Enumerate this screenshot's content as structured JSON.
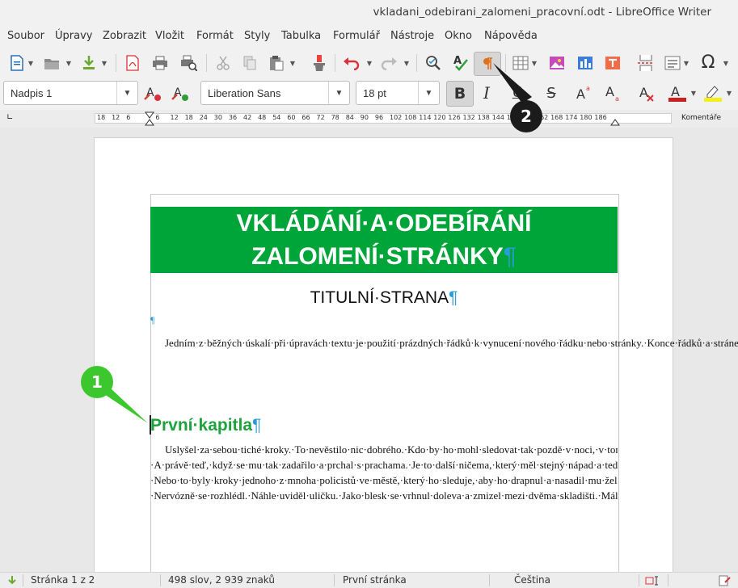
{
  "window": {
    "title": "vkladani_odebirani_zalomeni_pracovní.odt - LibreOffice Writer"
  },
  "menu": [
    "Soubor",
    "Úpravy",
    "Zobrazit",
    "Vložit",
    "Formát",
    "Styly",
    "Tabulka",
    "Formulář",
    "Nástroje",
    "Okno",
    "Nápověda"
  ],
  "format_bar": {
    "paragraph_style": "Nadpis 1",
    "font_name": "Liberation Sans",
    "font_size": "18 pt"
  },
  "ruler": {
    "numbers": [
      "18",
      "12",
      "6",
      "",
      "6",
      "12",
      "18",
      "24",
      "30",
      "36",
      "42",
      "48",
      "54",
      "60",
      "66",
      "72",
      "78",
      "84",
      "90",
      "96",
      "102",
      "108",
      "114",
      "120",
      "126",
      "132",
      "138",
      "144",
      "150",
      "156",
      "162",
      "168",
      "174",
      "180",
      "186"
    ],
    "comments_label": "Komentáře"
  },
  "document": {
    "title_line1": "VKLÁDÁNÍ·A·ODEBÍRÁNÍ",
    "title_line2": "ZALOMENÍ·STRÁNKY",
    "pilcrow": "¶",
    "subtitle": "TITULNÍ·STRANA",
    "intro": "Jedním·z·běžných·úskalí·při·úpravách·textu·je·použití·prázdných·řádků·k·vynucení·nového·řádku·nebo·stránky.·Konce·řádků·a·stránek·jsou·užitečné·malé·funkce·každé·aplikace·pro·zpracování·textu,·bohužel·většina·uživatelů·ignoruje·jejich·existenci.·Naučte·se·je·správně·používat·a·budete·vyčnívat·z·davu·průměrných·uživatelů.",
    "heading": "První·kapitla",
    "chapter_text": "Uslyšel·za·sebou·tiché·kroky.·To·nevěstilo·nic·dobrého.·Kdo·by·ho·mohl·sledovat·tak·pozdě·v·noci,·v·tomhle·zapomenutém·koutě·města?·A·právě·teď,·když·se·mu·tak·zadařilo·a·prchal·s·prachama.·Je·to·další·ničema,·který·měl·stejný·nápad·a·teď·ho·sleduje·a·čeká·na·svou·šanci,·aby·mu·vzal·plody·jeho·práce?·Nebo·to·byly·kroky·jednoho·z·mnoha·policistů·ve·městě,·který·ho·sleduje,·aby·ho·drapnul·a·nasadil·mu·želízka?·Nervózně·se·rozhlédl.·Náhle·uviděl·uličku.·Jako·blesk·se·vrhnul·doleva·a·zmizel·mezi·dvěma·skladišti.·Málem·přitom·zakopl·o·popelnici,·která·ležela·na·chodníku.·Nervózně·se·snažil·našmátrat·cestu·tmou·černou·jako·inkoust.·Náhle·ztuhl.·Byla·to·slepá·ulička.·Musí·se·vrátit·odkud·přišel.·Kroky·byly·stále·hlasitější.·Už·viděl·tmavou·siluetu·muže·"
  },
  "status": {
    "page": "Stránka 1 z 2",
    "words": "498 slov, 2 939 znaků",
    "page_style": "První stránka",
    "language": "Čeština"
  },
  "callouts": [
    "1",
    "2"
  ],
  "colors": {
    "banner": "#00a53a",
    "heading": "#1ea23e",
    "callout1": "#3cc72e",
    "callout2": "#1b1b1b",
    "pilcrow": "#2a9bd6"
  }
}
